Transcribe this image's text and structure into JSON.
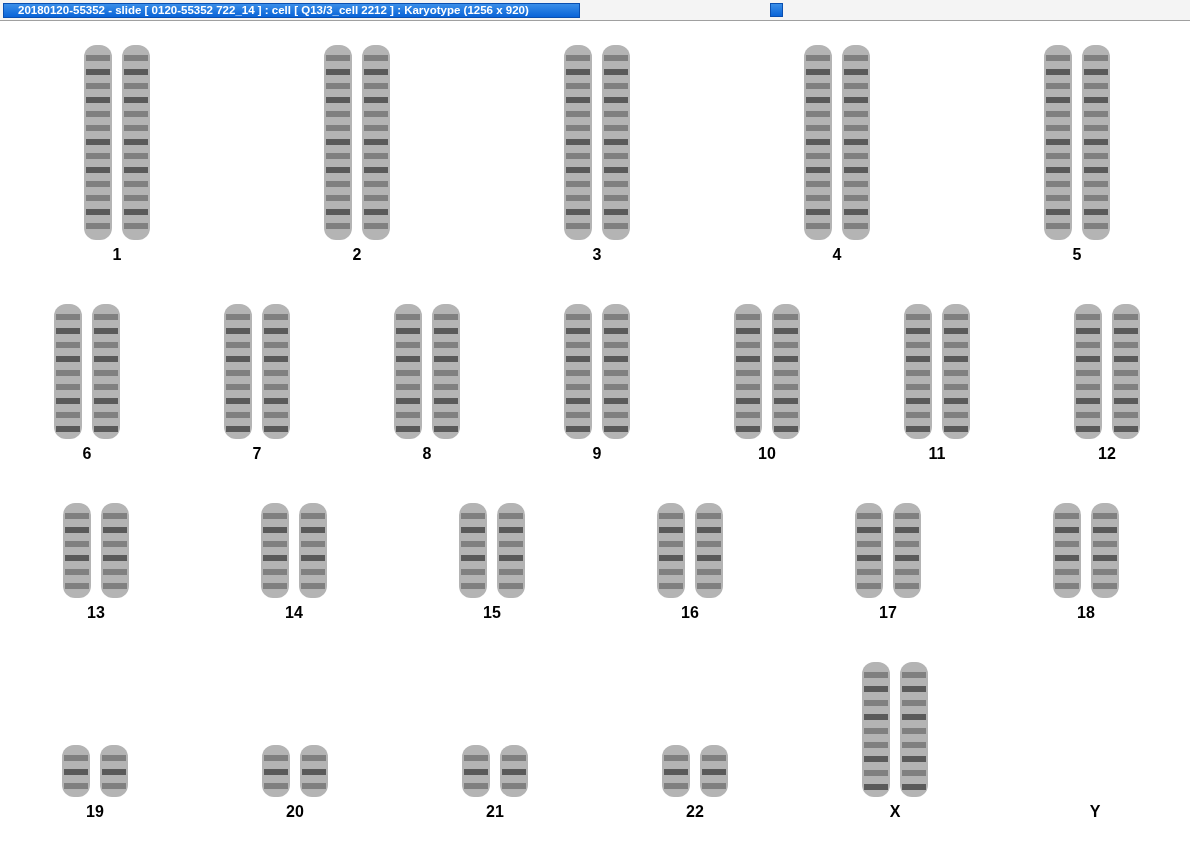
{
  "window": {
    "title": "20180120-55352 - slide [ 0120-55352 722_14 ] : cell [ Q13/3_cell 2212 ] : Karyotype  (1256 x 920)"
  },
  "karyotype": {
    "rows": [
      {
        "chromosomes": [
          {
            "label": "1",
            "kind": "long"
          },
          {
            "label": "2",
            "kind": "long"
          },
          {
            "label": "3",
            "kind": "long"
          },
          {
            "label": "4",
            "kind": "long"
          },
          {
            "label": "5",
            "kind": "long"
          }
        ]
      },
      {
        "chromosomes": [
          {
            "label": "6",
            "kind": "medium"
          },
          {
            "label": "7",
            "kind": "medium"
          },
          {
            "label": "8",
            "kind": "medium"
          },
          {
            "label": "9",
            "kind": "medium"
          },
          {
            "label": "10",
            "kind": "medium"
          },
          {
            "label": "11",
            "kind": "medium"
          },
          {
            "label": "12",
            "kind": "medium"
          }
        ]
      },
      {
        "chromosomes": [
          {
            "label": "13",
            "kind": "short"
          },
          {
            "label": "14",
            "kind": "short"
          },
          {
            "label": "15",
            "kind": "short"
          },
          {
            "label": "16",
            "kind": "short"
          },
          {
            "label": "17",
            "kind": "short"
          },
          {
            "label": "18",
            "kind": "short"
          }
        ]
      },
      {
        "chromosomes": [
          {
            "label": "19",
            "kind": "tiny"
          },
          {
            "label": "20",
            "kind": "tiny"
          },
          {
            "label": "21",
            "kind": "tiny"
          },
          {
            "label": "22",
            "kind": "tiny"
          },
          {
            "label": "X",
            "kind": "medium"
          },
          {
            "label": "Y",
            "kind": "none"
          }
        ]
      }
    ]
  }
}
